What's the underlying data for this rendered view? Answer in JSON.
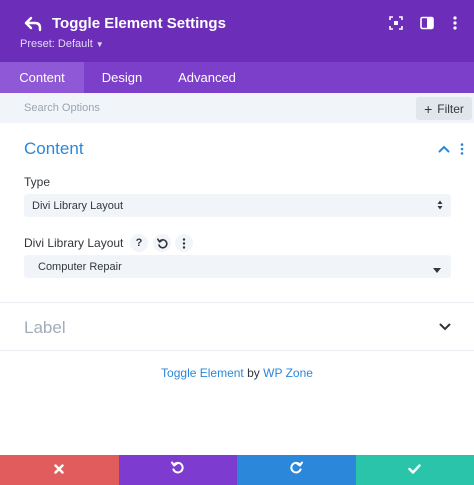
{
  "header": {
    "title": "Toggle Element Settings",
    "preset_label": "Preset: Default",
    "icons": [
      "back-arrow-icon",
      "expand-icon",
      "sidebar-toggle-icon",
      "more-vertical-icon"
    ],
    "background_color": "#6c2eb9"
  },
  "tabs": [
    {
      "label": "Content",
      "active": true
    },
    {
      "label": "Design",
      "active": false
    },
    {
      "label": "Advanced",
      "active": false
    }
  ],
  "search": {
    "placeholder": "Search Options",
    "filter_label": "Filter"
  },
  "content_section": {
    "title": "Content",
    "type_label": "Type",
    "type_value": "Divi Library Layout",
    "layout_label": "Divi Library Layout",
    "layout_value": "Computer Repair",
    "help_glyph": "?"
  },
  "label_section": {
    "title": "Label"
  },
  "credit": {
    "product": "Toggle Element",
    "by": "by",
    "vendor": "WP Zone"
  },
  "footer": {
    "buttons": [
      {
        "action": "cancel",
        "icon": "close-icon",
        "color": "#e15c5c"
      },
      {
        "action": "undo",
        "icon": "undo-icon",
        "color": "#7e3bd0"
      },
      {
        "action": "redo",
        "icon": "redo-icon",
        "color": "#2b87da"
      },
      {
        "action": "save",
        "icon": "check-icon",
        "color": "#29c4a9"
      }
    ]
  },
  "colors": {
    "accent_blue": "#2b87da",
    "tab_bar": "#7b3fc9",
    "active_tab": "#8f58d6",
    "field_bg": "#f1f5f9"
  }
}
